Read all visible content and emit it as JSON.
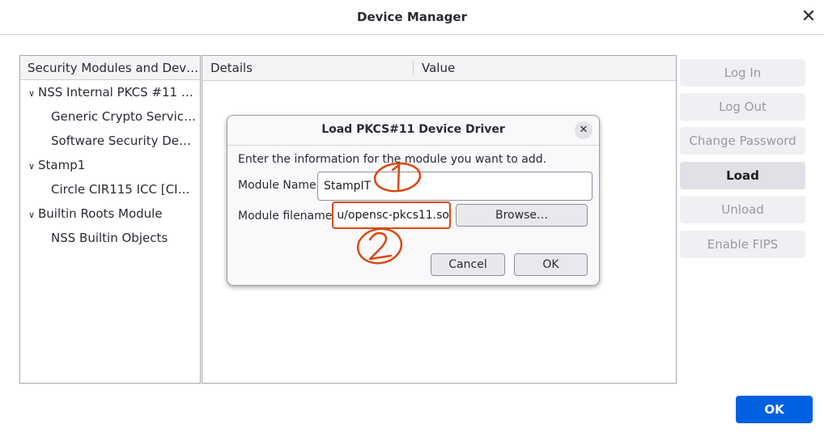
{
  "window": {
    "title": "Device Manager",
    "close_glyph": "✕"
  },
  "tree": {
    "header": "Security Modules and Devi…",
    "items": [
      {
        "label": "NSS Internal PKCS #11 Mod…",
        "level": 0,
        "expanded": true
      },
      {
        "label": "Generic Crypto Services",
        "level": 1
      },
      {
        "label": "Software Security Device",
        "level": 1
      },
      {
        "label": "Stamp1",
        "level": 0,
        "expanded": true
      },
      {
        "label": "Circle CIR115 ICC [CIR115 …",
        "level": 1
      },
      {
        "label": "Builtin Roots Module",
        "level": 0,
        "expanded": true
      },
      {
        "label": "NSS Builtin Objects",
        "level": 1
      }
    ],
    "twisty_glyph": "∨"
  },
  "details": {
    "col_details": "Details",
    "col_value": "Value"
  },
  "side_buttons": {
    "log_in": "Log In",
    "log_out": "Log Out",
    "change_password": "Change Password",
    "load": "Load",
    "unload": "Unload",
    "enable_fips": "Enable FIPS"
  },
  "main_ok": "OK",
  "dialog": {
    "title": "Load PKCS#11 Device Driver",
    "close_glyph": "✕",
    "intro": "Enter the information for the module you want to add.",
    "module_name_label": "Module Name",
    "module_name_value": "StampIT",
    "module_filename_label": "Module filename",
    "module_filename_value": "u/opensc-pkcs11.so",
    "browse": "Browse…",
    "cancel": "Cancel",
    "ok": "OK"
  },
  "colors": {
    "accent": "#0061e0",
    "annotation": "#d9480f",
    "focus_border": "#d9480f"
  }
}
